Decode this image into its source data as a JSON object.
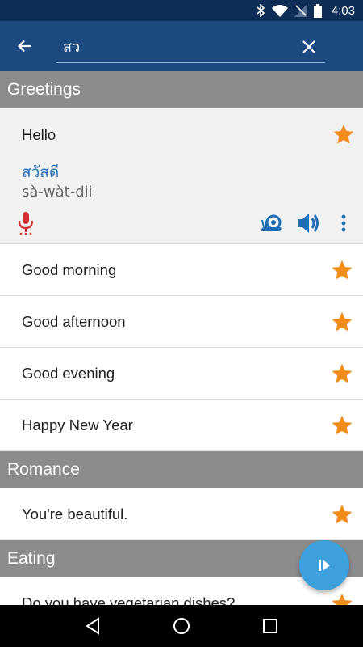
{
  "status_bar": {
    "time": "4:03"
  },
  "toolbar": {
    "search_value": "สว"
  },
  "sections": [
    {
      "title": "Greetings",
      "expanded_item": {
        "label": "Hello",
        "thai": "สวัสดี",
        "transliteration": "sà-wàt-dii"
      },
      "items": [
        "Good morning",
        "Good afternoon",
        "Good evening",
        "Happy New Year"
      ]
    },
    {
      "title": "Romance",
      "items": [
        "You're beautiful."
      ]
    },
    {
      "title": "Eating",
      "items": [
        "Do you have vegetarian dishes?"
      ]
    }
  ],
  "colors": {
    "toolbar": "#1d4a80",
    "status_bar": "#0f2e56",
    "star": "#f28c1a",
    "header": "#8c8c8c",
    "thai_text": "#1f6db5",
    "fab": "#3d9fdc",
    "mic": "#d32f2f"
  },
  "icons": [
    "arrow-back-icon",
    "close-icon",
    "star-icon",
    "microphone-icon",
    "snail-icon",
    "speaker-icon",
    "more-vert-icon",
    "play-icon"
  ]
}
